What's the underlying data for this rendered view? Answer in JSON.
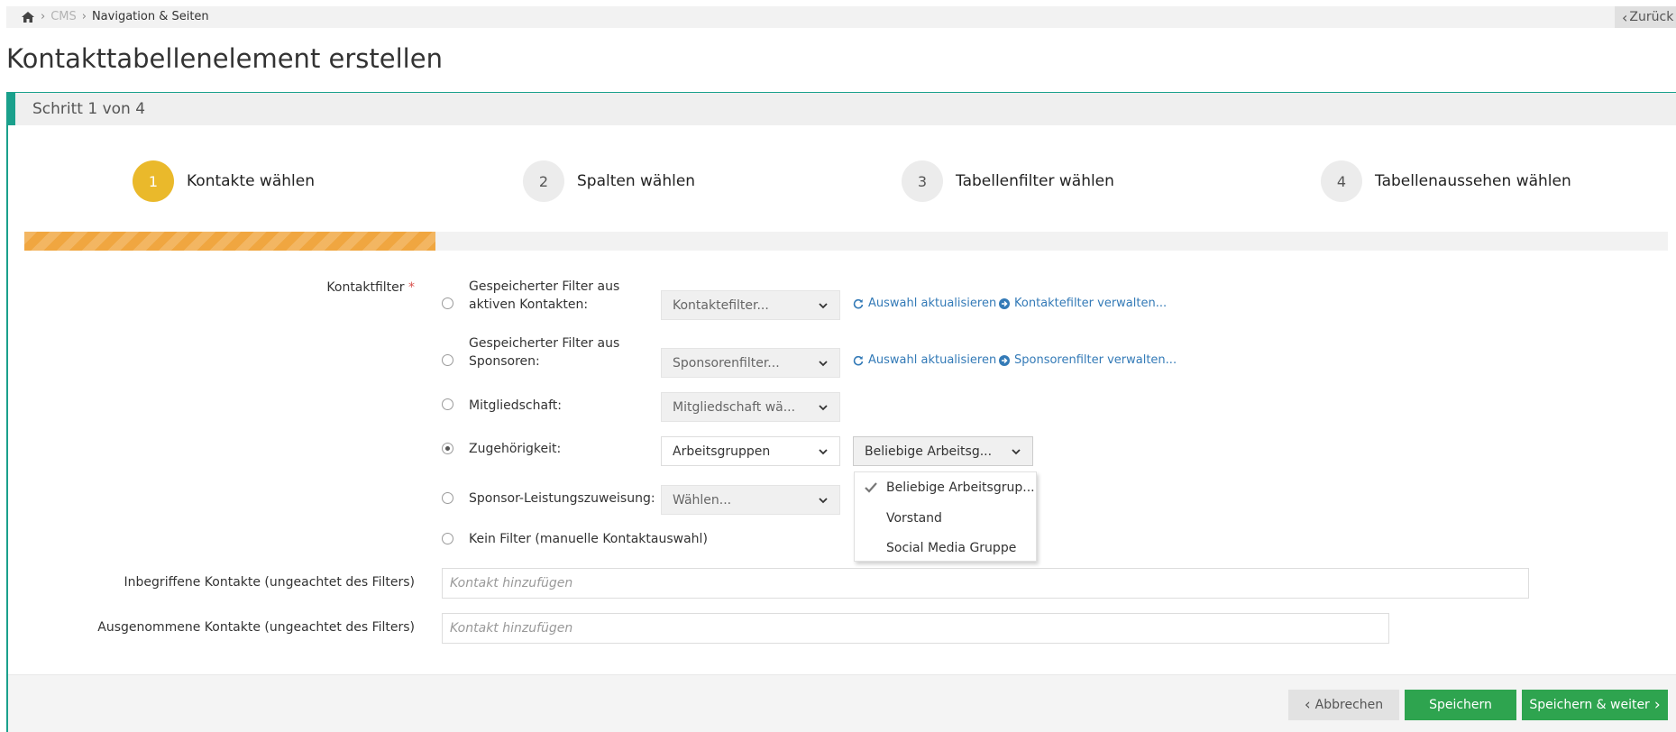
{
  "breadcrumb": {
    "home_icon": "home-icon",
    "items": [
      "CMS",
      "Navigation & Seiten"
    ]
  },
  "back_button": "Zurück",
  "page_title": "Kontakttabellenelement erstellen",
  "panel": {
    "heading": "Schritt 1 von 4",
    "accent_color": "#1aa08c"
  },
  "steps": [
    {
      "number": "1",
      "label": "Kontakte wählen",
      "active": true
    },
    {
      "number": "2",
      "label": "Spalten wählen",
      "active": false
    },
    {
      "number": "3",
      "label": "Tabellenfilter wählen",
      "active": false
    },
    {
      "number": "4",
      "label": "Tabellenaussehen wählen",
      "active": false
    }
  ],
  "progress": {
    "current_step": 1,
    "total_steps": 4,
    "color": "#f0a640"
  },
  "form": {
    "contact_filter_label": "Kontaktfilter",
    "required_mark": "*",
    "options": [
      {
        "label": "Gespeicherter Filter aus aktiven Kontakten:",
        "select": "Kontaktefilter...",
        "links": [
          "Auswahl aktualisieren",
          "Kontaktefilter verwalten..."
        ],
        "checked": false
      },
      {
        "label": "Gespeicherter Filter aus Sponsoren:",
        "select": "Sponsorenfilter...",
        "links": [
          "Auswahl aktualisieren",
          "Sponsorenfilter verwalten..."
        ],
        "checked": false
      },
      {
        "label": "Mitgliedschaft:",
        "select": "Mitgliedschaft wä...",
        "checked": false
      },
      {
        "label": "Zugehörigkeit:",
        "select": "Arbeitsgruppen",
        "select2": "Beliebige Arbeitsg...",
        "checked": true
      },
      {
        "label": "Sponsor-Leistungszuweisung:",
        "select": "Wählen...",
        "checked": false
      },
      {
        "label": "Kein Filter (manuelle Kontaktauswahl)",
        "checked": false
      }
    ],
    "dropdown_options": [
      "Beliebige Arbeitsgrup...",
      "Vorstand",
      "Social Media Gruppe"
    ],
    "included_label": "Inbegriffene Kontakte (ungeachtet des Filters)",
    "included_placeholder": "Kontakt hinzufügen",
    "excluded_label": "Ausgenommene Kontakte (ungeachtet des Filters)",
    "excluded_placeholder": "Kontakt hinzufügen"
  },
  "footer": {
    "cancel": "Abbrechen",
    "save": "Speichern",
    "save_next": "Speichern & weiter",
    "green": "#2ea44f"
  }
}
